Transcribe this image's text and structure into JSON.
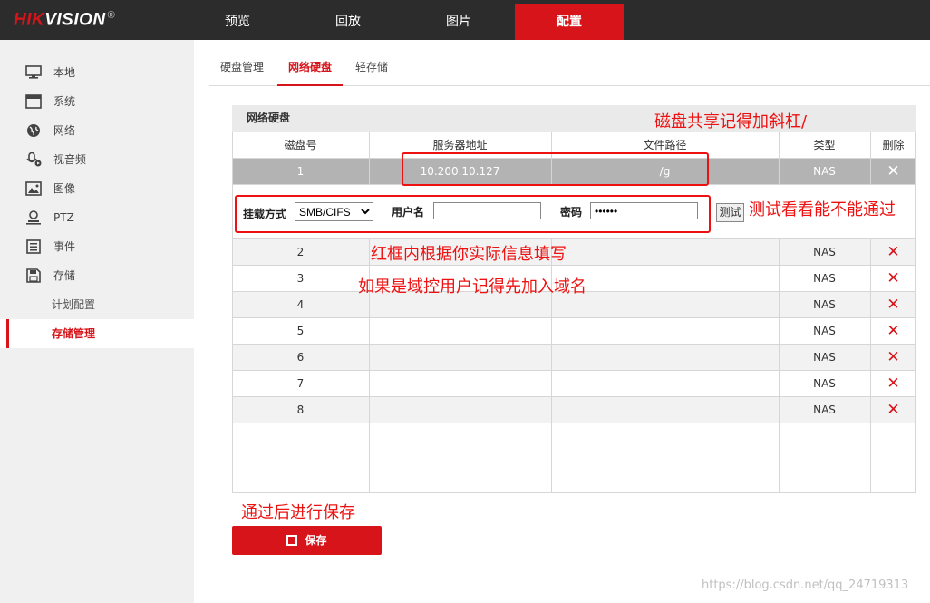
{
  "brand": {
    "logo_red": "HIK",
    "logo_white": "VISION",
    "reg": "®"
  },
  "nav": {
    "tabs": [
      {
        "label": "预览"
      },
      {
        "label": "回放"
      },
      {
        "label": "图片"
      },
      {
        "label": "配置"
      }
    ],
    "active": "配置"
  },
  "sidebar": {
    "items": [
      {
        "label": "本地",
        "icon": "monitor-icon"
      },
      {
        "label": "系统",
        "icon": "window-icon"
      },
      {
        "label": "网络",
        "icon": "globe-icon"
      },
      {
        "label": "视音频",
        "icon": "microphone-icon"
      },
      {
        "label": "图像",
        "icon": "image-icon"
      },
      {
        "label": "PTZ",
        "icon": "user-camera-icon"
      },
      {
        "label": "事件",
        "icon": "list-icon"
      },
      {
        "label": "存储",
        "icon": "floppy-icon"
      }
    ],
    "subitems": [
      {
        "label": "计划配置"
      },
      {
        "label": "存储管理"
      }
    ]
  },
  "subtabs": [
    {
      "label": "硬盘管理"
    },
    {
      "label": "网络硬盘"
    },
    {
      "label": "轻存储"
    }
  ],
  "panel": {
    "title": "网络硬盘",
    "columns": [
      "磁盘号",
      "服务器地址",
      "文件路径",
      "类型",
      "删除"
    ],
    "rows": [
      {
        "no": "1",
        "addr": "10.200.10.127",
        "path": "/g",
        "type": "NAS"
      },
      {
        "no": "2",
        "addr": "",
        "path": "",
        "type": "NAS"
      },
      {
        "no": "3",
        "addr": "",
        "path": "",
        "type": "NAS"
      },
      {
        "no": "4",
        "addr": "",
        "path": "",
        "type": "NAS"
      },
      {
        "no": "5",
        "addr": "",
        "path": "",
        "type": "NAS"
      },
      {
        "no": "6",
        "addr": "",
        "path": "",
        "type": "NAS"
      },
      {
        "no": "7",
        "addr": "",
        "path": "",
        "type": "NAS"
      },
      {
        "no": "8",
        "addr": "",
        "path": "",
        "type": "NAS"
      }
    ],
    "delete_glyph": "✕",
    "mount": {
      "mode_label": "挂载方式",
      "mode_value": "SMB/CIFS",
      "user_label": "用户名",
      "user_value": "",
      "pwd_label": "密码",
      "pwd_value": "••••••",
      "test_label": "测试"
    }
  },
  "save": {
    "label": "保存"
  },
  "annotations": {
    "slash": "磁盘共享记得加斜杠/",
    "test": "测试看看能不能通过",
    "fill": "红框内根据你实际信息填写",
    "domain": "如果是域控用户记得先加入域名",
    "save": "通过后进行保存"
  },
  "watermark": "https://blog.csdn.net/qq_24719313",
  "colors": {
    "accent": "#d7141a",
    "topbar": "#2c2c2c",
    "annotation": "#ee1111"
  }
}
